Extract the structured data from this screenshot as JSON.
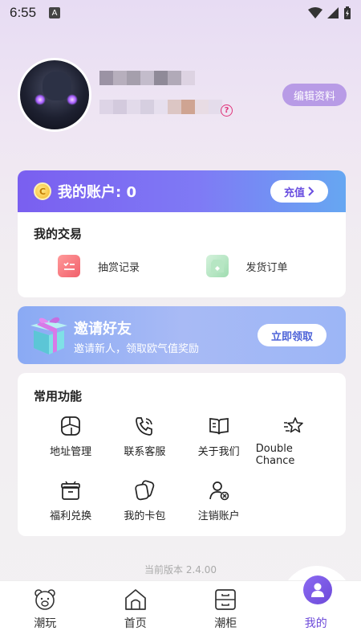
{
  "status_bar": {
    "time": "6:55",
    "badge": "A"
  },
  "profile": {
    "edit_label": "编辑资料",
    "help_glyph": "?"
  },
  "account": {
    "coin_glyph": "C",
    "title": "我的账户: 0",
    "recharge_label": "充值"
  },
  "trades": {
    "title": "我的交易",
    "items": [
      {
        "label": "抽赏记录"
      },
      {
        "label": "发货订单"
      }
    ]
  },
  "invite": {
    "title": "邀请好友",
    "subtitle": "邀请新人，领取欧气值奖励",
    "button": "立即领取"
  },
  "functions": {
    "title": "常用功能",
    "items": [
      {
        "label": "地址管理",
        "icon": "address-icon"
      },
      {
        "label": "联系客服",
        "icon": "phone-icon"
      },
      {
        "label": "关于我们",
        "icon": "book-icon"
      },
      {
        "label": "Double Chance",
        "icon": "star-icon"
      },
      {
        "label": "福利兑换",
        "icon": "gift-box-icon"
      },
      {
        "label": "我的卡包",
        "icon": "cards-icon"
      },
      {
        "label": "注销账户",
        "icon": "user-remove-icon"
      }
    ]
  },
  "version": "当前版本 2.4.00",
  "tabs": [
    {
      "label": "潮玩",
      "icon": "bear-icon"
    },
    {
      "label": "首页",
      "icon": "home-icon"
    },
    {
      "label": "潮柜",
      "icon": "cabinet-icon"
    },
    {
      "label": "我的",
      "icon": "profile-icon",
      "active": true
    }
  ],
  "colors": {
    "accent": "#6d4ad9",
    "account_gradient_start": "#7a5ff0",
    "account_gradient_end": "#66a7f2",
    "edit_button": "#b89be6"
  }
}
